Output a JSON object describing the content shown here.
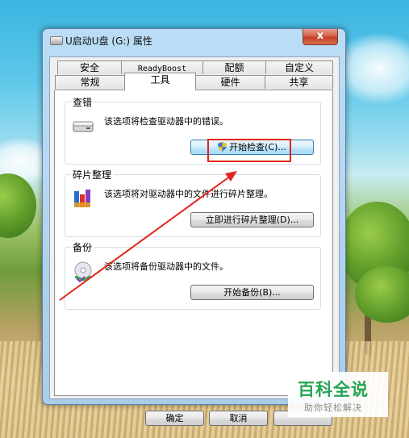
{
  "window": {
    "title": "U启动U盘 (G:) 属性",
    "close_label": "x"
  },
  "tabs_row1": [
    {
      "label": "安全"
    },
    {
      "label": "ReadyBoost"
    },
    {
      "label": "配额"
    },
    {
      "label": "自定义"
    }
  ],
  "tabs_row2": [
    {
      "label": "常规"
    },
    {
      "label": "工具",
      "active": true
    },
    {
      "label": "硬件"
    },
    {
      "label": "共享"
    }
  ],
  "groups": {
    "check": {
      "title": "查错",
      "description": "该选项将检查驱动器中的错误。",
      "button": "开始检查(C)..."
    },
    "defrag": {
      "title": "碎片整理",
      "description": "该选项将对驱动器中的文件进行碎片整理。",
      "button": "立即进行碎片整理(D)..."
    },
    "backup": {
      "title": "备份",
      "description": "该选项将备份驱动器中的文件。",
      "button": "开始备份(B)..."
    }
  },
  "footer": {
    "ok": "确定",
    "cancel": "取消"
  },
  "watermark": {
    "title": "百科全说",
    "subtitle": "助你轻松解决"
  },
  "colors": {
    "annotation_red": "#e1261c",
    "watermark_green": "#23a453",
    "window_frame": "#a8cdec"
  }
}
